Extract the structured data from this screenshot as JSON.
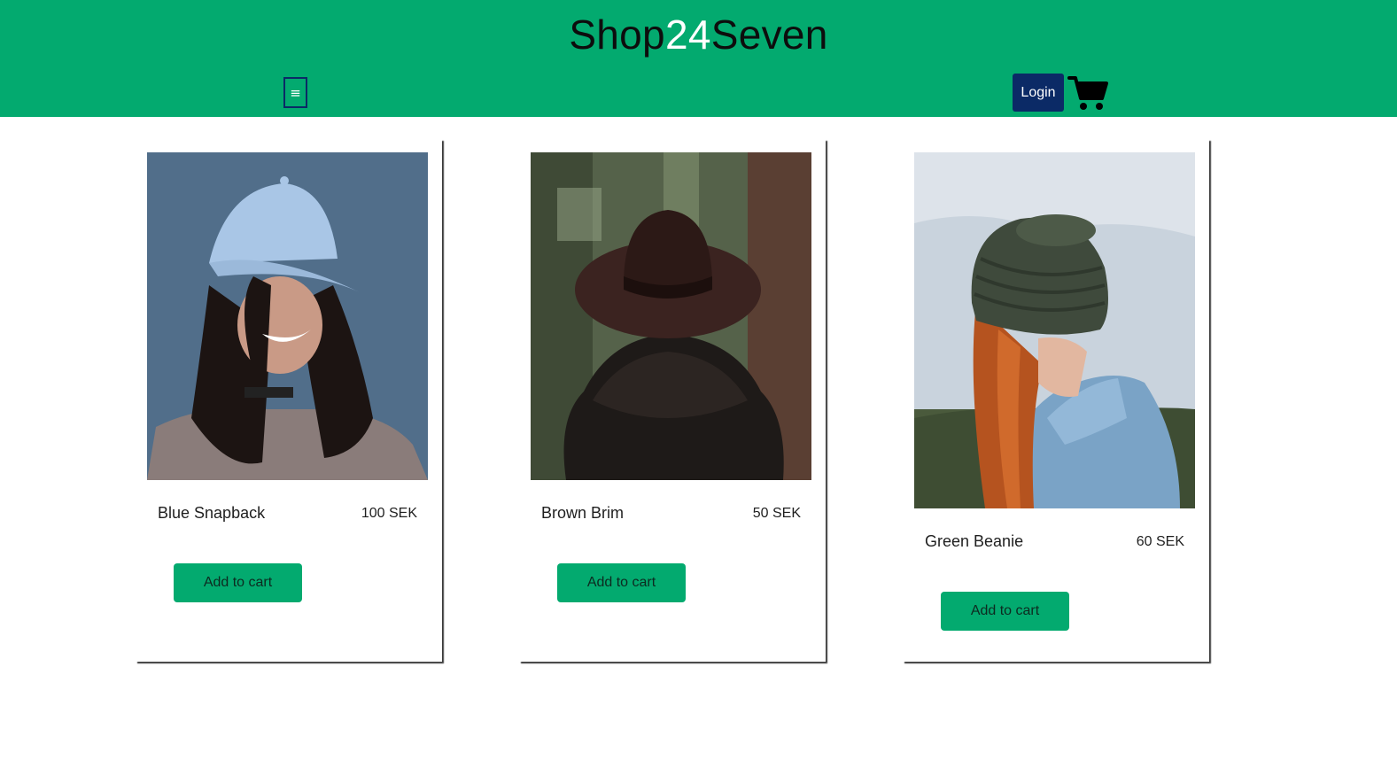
{
  "header": {
    "logo_part1": "Shop",
    "logo_part2": "24",
    "logo_part3": "Seven",
    "menu_icon_glyph": "≡",
    "login_label": "Login",
    "cart_icon": "shopping-cart-icon"
  },
  "colors": {
    "brand_green": "#03aa6f",
    "navy": "#0b2a66",
    "text_dark": "#1f1f1f"
  },
  "products": [
    {
      "name": "Blue Snapback",
      "price": "100 SEK",
      "button_label": "Add to cart",
      "image": "woman-blue-cap-photo"
    },
    {
      "name": "Brown Brim",
      "price": "50 SEK",
      "button_label": "Add to cart",
      "image": "brown-fedora-back-photo"
    },
    {
      "name": "Green Beanie",
      "price": "60 SEK",
      "button_label": "Add to cart",
      "image": "green-beanie-redhead-photo"
    }
  ]
}
